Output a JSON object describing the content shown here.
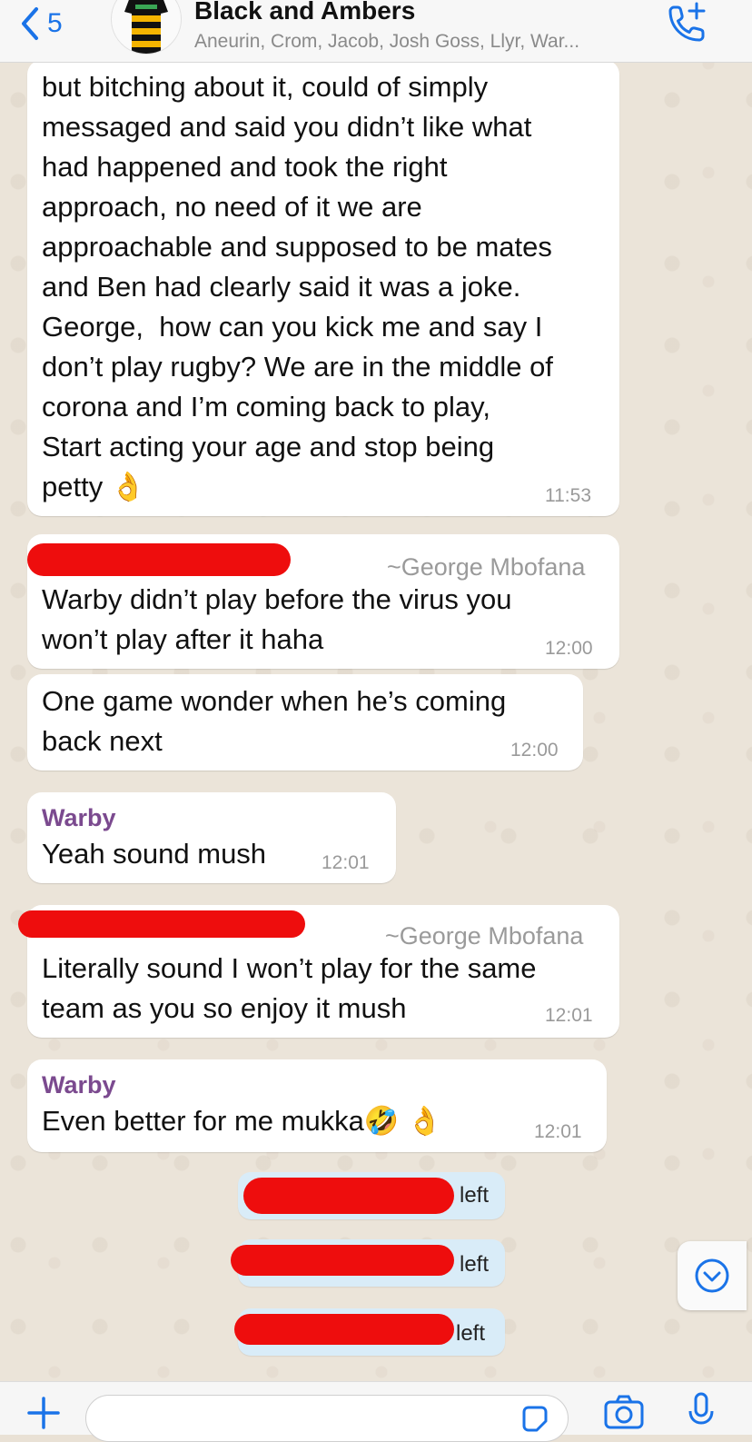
{
  "header": {
    "back_count": "5",
    "title": "Black and Ambers",
    "subtitle": "Aneurin, Crom, Jacob, Josh Goss, Llyr, War...",
    "accent": "#1a73e8"
  },
  "messages": [
    {
      "lines": [
        "but bitching about it, could of simply",
        "messaged and said you didn’t like what",
        "had happened and took the right",
        "approach, no need of it we are",
        "approachable and supposed to be mates",
        "and Ben had clearly said it was a joke.",
        "George,  how can you kick me and say I",
        "don’t play rugby? We are in the middle of",
        "corona and I’m coming back to play,",
        "Start acting your age and stop being",
        "petty 👌"
      ],
      "time": "11:53"
    },
    {
      "sender": "~George Mbofana",
      "lines": [
        "Warby didn’t play before the virus you",
        "won’t play after it haha"
      ],
      "time": "12:00"
    },
    {
      "lines": [
        "One game wonder when he’s coming",
        "back next"
      ],
      "time": "12:00"
    },
    {
      "sender": "Warby",
      "lines": [
        "Yeah sound mush"
      ],
      "time": "12:01"
    },
    {
      "sender": "~George Mbofana",
      "lines": [
        "Literally sound I won’t play for the same",
        "team as you so enjoy it mush"
      ],
      "time": "12:01"
    },
    {
      "sender": "Warby",
      "lines": [
        "Even better for me mukka🤣 👌"
      ],
      "time": "12:01"
    }
  ],
  "system_notices": [
    {
      "label": "left"
    },
    {
      "label": "left"
    },
    {
      "label": "left"
    }
  ],
  "colors": {
    "bubble": "#ffffff",
    "system_bubble": "#d9ecf8",
    "sender_purple": "#7b4a8f",
    "redaction": "#ee0d0d",
    "icon_blue": "#1a73e8"
  },
  "icons": {
    "back": "chevron-left-icon",
    "call": "add-call-icon",
    "attach": "plus-icon",
    "sticker": "sticker-icon",
    "camera": "camera-icon",
    "mic": "microphone-icon",
    "scroll": "chevron-down-circle-icon"
  }
}
